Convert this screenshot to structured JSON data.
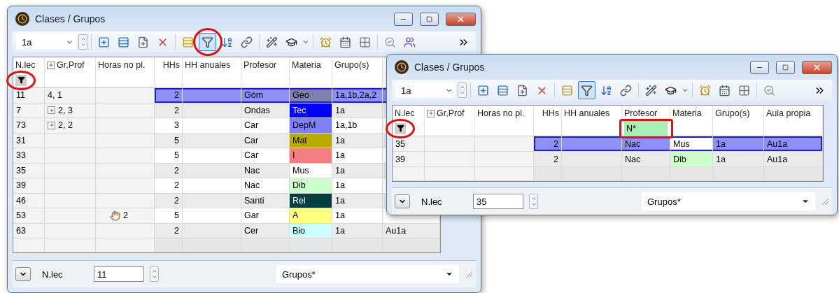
{
  "windows": [
    {
      "title": "Clases / Grupos",
      "toolbar": {
        "combo": "1a",
        "filter_pressed": true
      },
      "columns": [
        {
          "label": "N.lec"
        },
        {
          "label": "Gr,Prof",
          "expand_icon": true
        },
        {
          "label": "Horas no pl."
        },
        {
          "label": "HHs"
        },
        {
          "label": "HH anuales"
        },
        {
          "label": "Profesor"
        },
        {
          "label": "Materia"
        },
        {
          "label": "Grupo(s)"
        },
        {}
      ],
      "filter": {
        "active": true
      },
      "rows": [
        {
          "n_lec": "11",
          "gr_prof": "4, 1",
          "gr_expandable": false,
          "hhs": "2",
          "profesor": "Góm",
          "materia": "Geo",
          "color": "#7f7fb2",
          "grupos": "1a,1b,2a,2",
          "selected": true
        },
        {
          "n_lec": "7",
          "gr_prof": "2, 3",
          "gr_expandable": true,
          "hhs": "2",
          "profesor": "Ondas",
          "materia": "Tec",
          "color": "#0000ff",
          "grupos": "1a",
          "selected": false
        },
        {
          "n_lec": "73",
          "gr_prof": "2, 2",
          "gr_expandable": true,
          "hhs": "3",
          "profesor": "Car",
          "materia": "DepM",
          "color": "#8080ff",
          "grupos": "1a,1b",
          "selected": false
        },
        {
          "n_lec": "31",
          "gr_expandable": false,
          "hhs": "5",
          "profesor": "Car",
          "materia": "Mat",
          "color": "#b9aa00",
          "grupos": "1a",
          "selected": false
        },
        {
          "n_lec": "33",
          "gr_expandable": false,
          "hhs": "5",
          "profesor": "Car",
          "materia": "I",
          "color": "#f28080",
          "grupos": "1a",
          "selected": false
        },
        {
          "n_lec": "35",
          "gr_expandable": false,
          "hhs": "2",
          "profesor": "Nac",
          "materia": "Mus",
          "color": "#ffffff",
          "grupos": "1a",
          "selected": false
        },
        {
          "n_lec": "39",
          "gr_expandable": false,
          "hhs": "2",
          "profesor": "Nac",
          "materia": "Dib",
          "color": "#ccffcc",
          "grupos": "1a",
          "selected": false
        },
        {
          "n_lec": "46",
          "gr_expandable": false,
          "hhs": "2",
          "profesor": "Santi",
          "materia": "Rel",
          "color": "#004040",
          "grupos": "1a",
          "selected": false
        },
        {
          "n_lec": "53",
          "gr_expandable": false,
          "horas_no_pl": "2",
          "hhs": "5",
          "profesor": "Gar",
          "materia": "A",
          "color": "#ffff80",
          "grupos": "1a",
          "selected": false
        },
        {
          "n_lec": "63",
          "gr_expandable": false,
          "hhs": "2",
          "profesor": "Cer",
          "materia": "Bio",
          "color": "#ccffff",
          "grupos": "1a",
          "aula": "Au1a",
          "selected": false
        }
      ],
      "bottom": {
        "label": "N.lec",
        "value": "11",
        "select": "Grupos*"
      }
    },
    {
      "title": "Clases / Grupos",
      "toolbar": {
        "combo": "1a",
        "filter_pressed": true
      },
      "columns": [
        {
          "label": "N.lec"
        },
        {
          "label": "Gr,Prof",
          "expand_icon": true
        },
        {
          "label": "Horas no pl."
        },
        {
          "label": "HHs"
        },
        {
          "label": "HH anuales"
        },
        {
          "label": "Profesor",
          "filter": "N*"
        },
        {
          "label": "Materia"
        },
        {
          "label": "Grupo(s)"
        },
        {
          "label": "Aula propia"
        }
      ],
      "filter": {
        "active": true
      },
      "rows": [
        {
          "n_lec": "35",
          "gr_expandable": false,
          "hhs": "2",
          "profesor": "Nac",
          "materia": "Mus",
          "color": "#ffffff",
          "grupos": "1a",
          "aula": "Au1a",
          "selected": true
        },
        {
          "n_lec": "39",
          "gr_expandable": false,
          "hhs": "2",
          "profesor": "Nac",
          "materia": "Dib",
          "color": "#ccffcc",
          "grupos": "1a",
          "aula": "Au1a",
          "selected": false
        }
      ],
      "bottom": {
        "label": "N.lec",
        "value": "35",
        "select": "Grupos*"
      }
    }
  ]
}
